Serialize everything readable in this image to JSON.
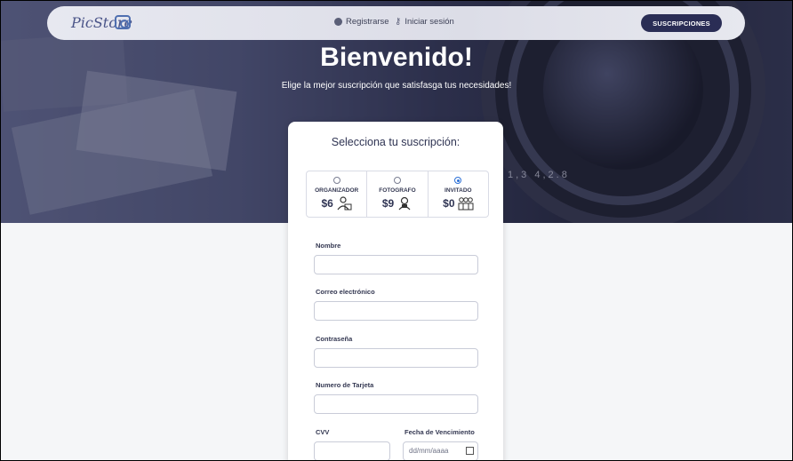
{
  "navbar": {
    "logo_text": "PicStore",
    "register_label": "Registrarse",
    "login_label": "Iniciar sesión",
    "subscriptions_label": "SUSCRIPCIONES"
  },
  "hero": {
    "title": "Bienvenido!",
    "subtitle": "Elige la mejor suscripción que satisfasga tus necesidades!",
    "lens_text": "1,3   4,2.8"
  },
  "card": {
    "title": "Selecciona tu suscripción:",
    "plans": [
      {
        "name": "ORGANIZADOR",
        "price": "$6",
        "icon": "organizer-icon",
        "selected": false
      },
      {
        "name": "FOTOGRAFO",
        "price": "$9",
        "icon": "photographer-icon",
        "selected": false
      },
      {
        "name": "INVITADO",
        "price": "$0",
        "icon": "guest-icon",
        "selected": true
      }
    ],
    "fields": {
      "name_label": "Nombre",
      "email_label": "Correo electrónico",
      "password_label": "Contraseña",
      "card_label": "Numero de Tarjeta",
      "cvv_label": "CVV",
      "expiry_label": "Fecha de Vencimiento",
      "expiry_placeholder": "dd/mm/aaaa"
    }
  },
  "colors": {
    "accent": "#2a2d55",
    "radio_selected": "#2b6fd6"
  }
}
